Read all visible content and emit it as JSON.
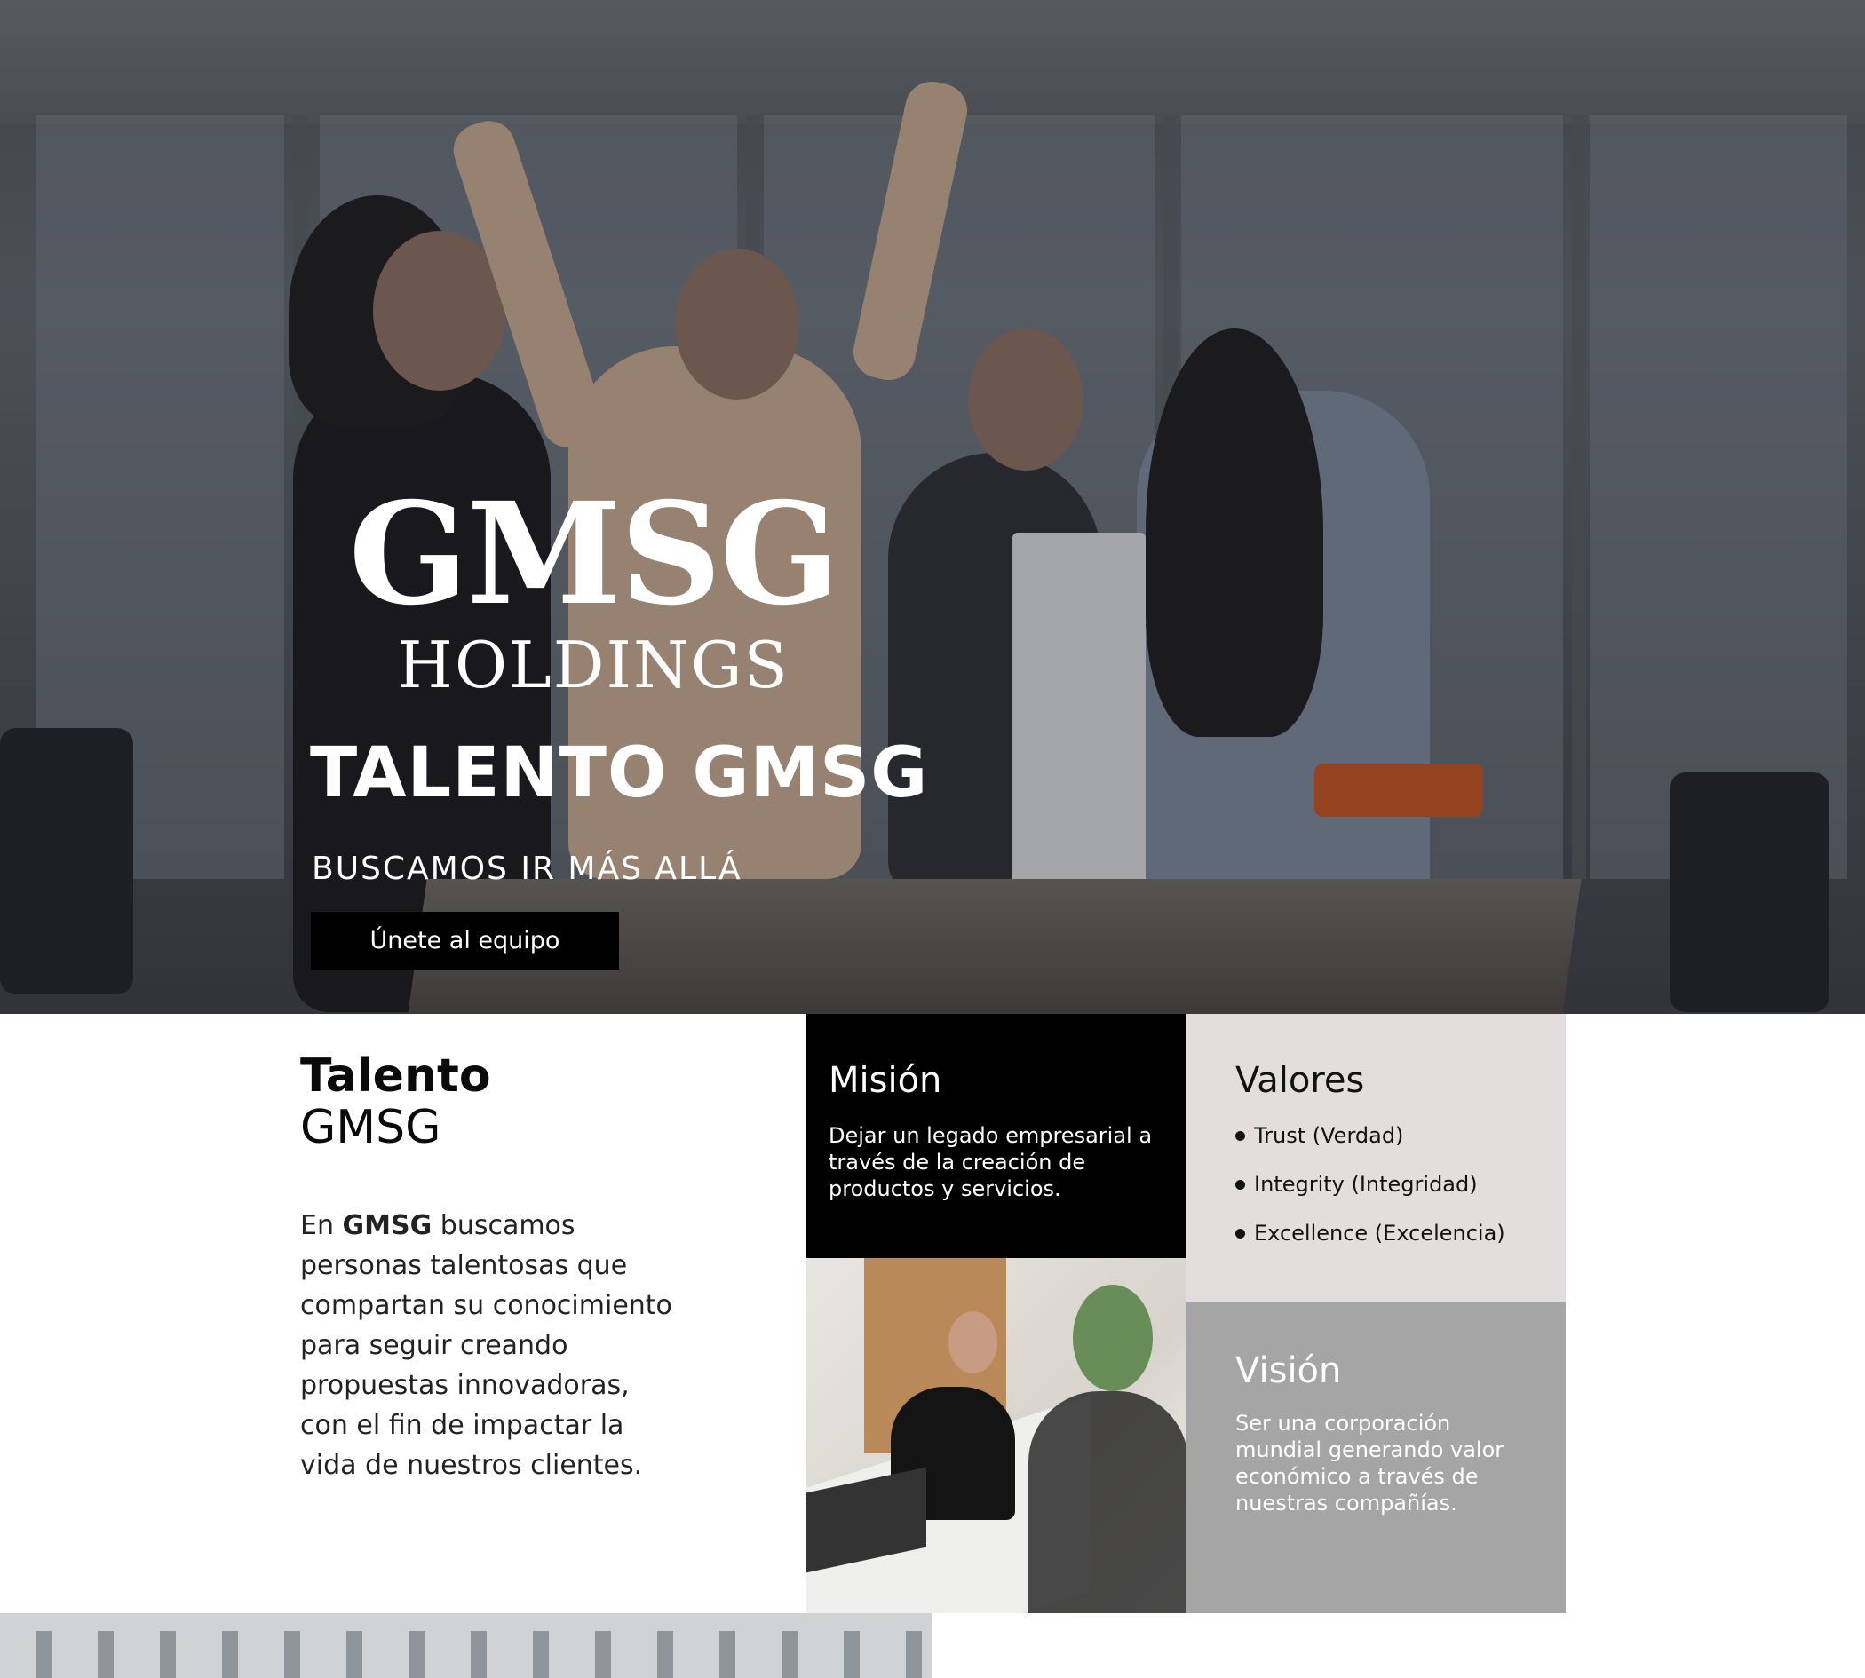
{
  "hero": {
    "logo_main": "GMSG",
    "logo_sub": "HOLDINGS",
    "title": "TALENTO GMSG",
    "subtitle": "BUSCAMOS IR MÁS ALLÁ",
    "cta_label": "Únete al equipo"
  },
  "talent": {
    "title_bold": "Talento",
    "title_light": "GMSG",
    "text_prefix": "En ",
    "text_bold": "GMSG",
    "text_rest": " buscamos personas talentosas que compartan su conocimiento para seguir creando propuestas innovadoras, con el fin de impactar la vida de nuestros clientes."
  },
  "mision": {
    "title": "Misión",
    "text": "Dejar un legado empresarial a través de la creación de productos y servicios."
  },
  "valores": {
    "title": "Valores",
    "items": [
      "Trust (Verdad)",
      "Integrity (Integridad)",
      "Excellence (Excelencia)"
    ]
  },
  "vision": {
    "title": "Visión",
    "text": "Ser una corporación mundial generando valor económico a través de nuestras compañías."
  },
  "colors": {
    "mision_bg": "#000000",
    "valores_bg": "#e4dddd",
    "vision_bg": "#a5a5a5",
    "cta_bg": "#000000"
  }
}
